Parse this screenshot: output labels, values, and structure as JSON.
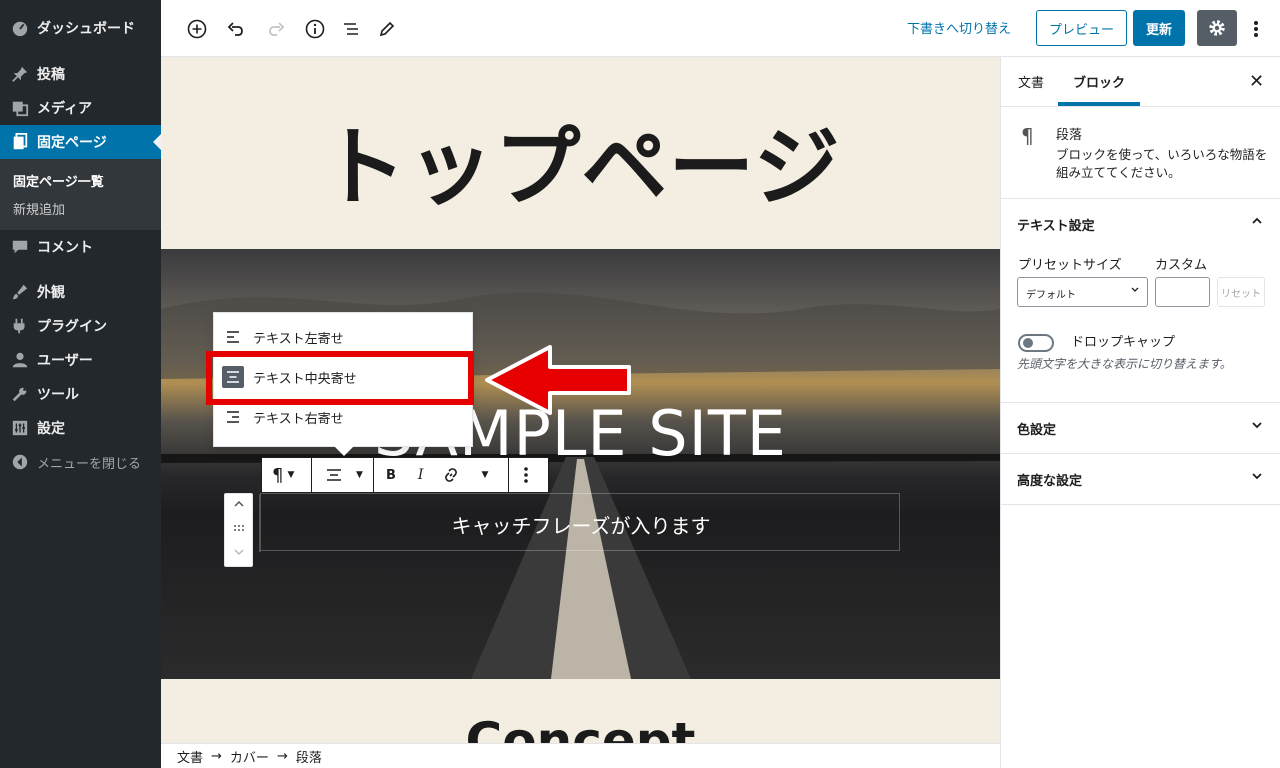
{
  "sidebar": {
    "items": [
      {
        "label": "ダッシュボード",
        "icon": "dashboard-icon"
      },
      {
        "label": "投稿",
        "icon": "pin-icon"
      },
      {
        "label": "メディア",
        "icon": "media-icon"
      },
      {
        "label": "固定ページ",
        "icon": "pages-icon"
      },
      {
        "label": "コメント",
        "icon": "comment-icon"
      },
      {
        "label": "外観",
        "icon": "brush-icon"
      },
      {
        "label": "プラグイン",
        "icon": "plugin-icon"
      },
      {
        "label": "ユーザー",
        "icon": "user-icon"
      },
      {
        "label": "ツール",
        "icon": "wrench-icon"
      },
      {
        "label": "設定",
        "icon": "settings-icon"
      },
      {
        "label": "メニューを閉じる",
        "icon": "collapse-icon"
      }
    ],
    "submenu": [
      "固定ページ一覧",
      "新規追加"
    ],
    "active_color": "#0073aa"
  },
  "toolbar": {
    "draft_label": "下書きへ切り替え",
    "preview_label": "プレビュー",
    "update_label": "更新"
  },
  "canvas": {
    "page_title": "トップページ",
    "site_title": "SAMPLE SITE",
    "catchphrase": "キャッチフレーズが入ります",
    "next_heading": "Concept"
  },
  "align_menu": {
    "items": [
      "テキスト左寄せ",
      "テキスト中央寄せ",
      "テキスト右寄せ"
    ],
    "selected": "テキスト中央寄せ",
    "annotation_color": "#e60000"
  },
  "panel": {
    "tabs": [
      "文書",
      "ブロック"
    ],
    "active_tab": "ブロック",
    "block_name": "段落",
    "block_desc": "ブロックを使って、いろいろな物語を組み立ててください。",
    "text_settings": "テキスト設定",
    "preset_label": "プリセットサイズ",
    "custom_label": "カスタム",
    "preset_value": "デフォルト",
    "reset_label": "リセット",
    "dropcap_label": "ドロップキャップ",
    "dropcap_help": "先頭文字を大きな表示に切り替えます。",
    "color_settings": "色設定",
    "advanced_settings": "高度な設定"
  },
  "breadcrumb": [
    "文書",
    "カバー",
    "段落"
  ]
}
